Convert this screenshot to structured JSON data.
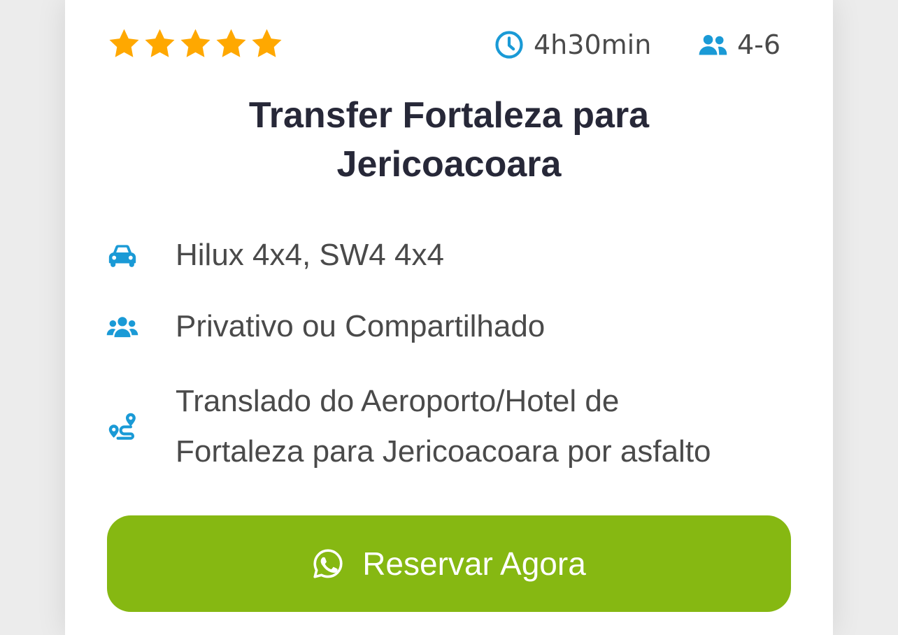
{
  "rating": {
    "stars": 5,
    "max": 5,
    "color": "#FFA800"
  },
  "meta": {
    "duration": "4h30min",
    "capacity": "4-6",
    "icon_color": "#1a9ad6",
    "icons": [
      "clock-icon",
      "users-icon"
    ]
  },
  "title": {
    "line1": "Transfer Fortaleza para",
    "line2": "Jericoacoara"
  },
  "features": [
    {
      "icon": "car-icon",
      "text": "Hilux 4x4, SW4 4x4"
    },
    {
      "icon": "group-icon",
      "text": "Privativo ou Compartilhado"
    },
    {
      "icon": "route-icon",
      "text_line1": "Translado do Aeroporto/Hotel de",
      "text_line2": "Fortaleza para Jericoacoara por asfalto"
    }
  ],
  "cta": {
    "label": "Reservar Agora",
    "icon": "whatsapp-icon",
    "background": "#86b812"
  }
}
